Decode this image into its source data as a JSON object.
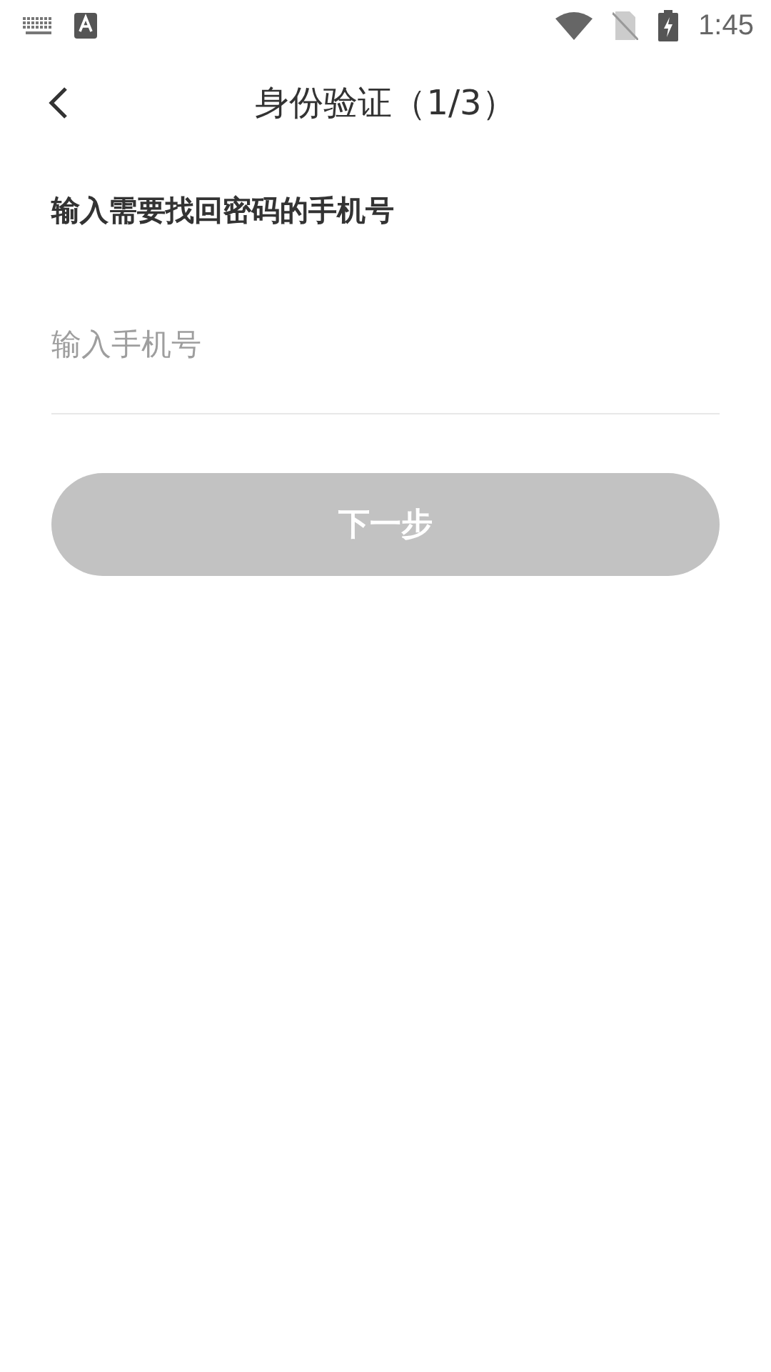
{
  "status_bar": {
    "time": "1:45"
  },
  "header": {
    "title": "身份验证（1/3）"
  },
  "heading": "输入需要找回密码的手机号",
  "phone_field": {
    "placeholder": "输入手机号"
  },
  "next_button": {
    "label": "下一步",
    "disabled": true
  }
}
